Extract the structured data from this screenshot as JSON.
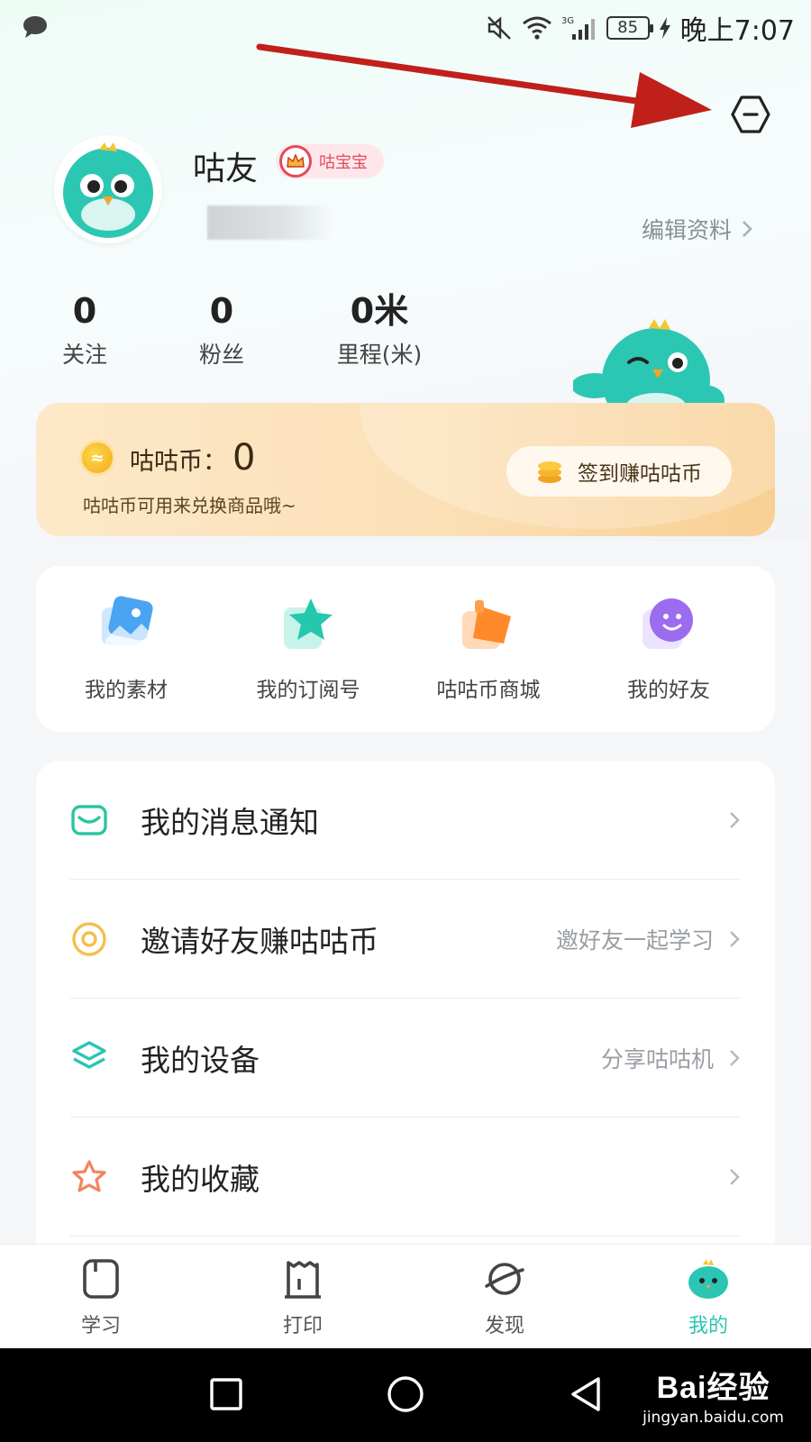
{
  "status_bar": {
    "time": "晚上7:07",
    "battery": "85",
    "network": "3G"
  },
  "profile": {
    "username": "咕友",
    "badge": "咕宝宝",
    "edit_label": "编辑资料"
  },
  "stats": [
    {
      "value": "0",
      "label": "关注"
    },
    {
      "value": "0",
      "label": "粉丝"
    },
    {
      "value": "0米",
      "label": "里程(米)"
    }
  ],
  "coin_card": {
    "label": "咕咕币：",
    "value": "0",
    "description": "咕咕币可用来兑换商品哦~",
    "button": "签到赚咕咕币",
    "coin_glyph": "≈"
  },
  "grid": [
    {
      "label": "我的素材",
      "icon": "material-icon"
    },
    {
      "label": "我的订阅号",
      "icon": "star-subscription-icon"
    },
    {
      "label": "咕咕币商城",
      "icon": "shop-icon"
    },
    {
      "label": "我的好友",
      "icon": "friend-icon"
    }
  ],
  "list": [
    {
      "label": "我的消息通知",
      "sub": "",
      "icon": "message-icon"
    },
    {
      "label": "邀请好友赚咕咕币",
      "sub": "邀好友一起学习",
      "icon": "invite-icon"
    },
    {
      "label": "我的设备",
      "sub": "分享咕咕机",
      "icon": "device-icon"
    },
    {
      "label": "我的收藏",
      "sub": "",
      "icon": "favorite-icon"
    }
  ],
  "bottom_nav": [
    {
      "label": "学习"
    },
    {
      "label": "打印"
    },
    {
      "label": "发现"
    },
    {
      "label": "我的",
      "active": true
    }
  ],
  "watermark": {
    "brand": "Bai经验",
    "url": "jingyan.baidu.com"
  },
  "colors": {
    "accent": "#2bc5b4",
    "annotation_arrow": "#c0201a",
    "coin_card": "#fbe0b6"
  }
}
